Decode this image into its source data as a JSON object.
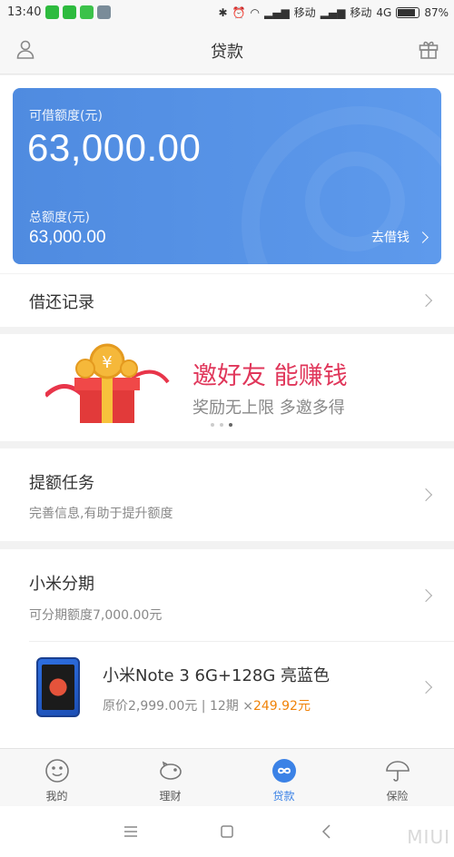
{
  "status_bar": {
    "time": "13:40",
    "carrier1": "移动",
    "carrier2": "移动",
    "network": "4G",
    "battery": "87%"
  },
  "app_bar": {
    "title": "贷款",
    "left_icon": "user-icon",
    "right_icon": "gift-icon"
  },
  "credit_card": {
    "available_label": "可借额度(元)",
    "available_amount": "63,000.00",
    "total_label": "总额度(元)",
    "total_amount": "63,000.00",
    "action_label": "去借钱"
  },
  "records": {
    "label": "借还记录"
  },
  "banner": {
    "headline": "邀好友 能赚钱",
    "subline": "奖励无上限 多邀多得",
    "page_count": 3,
    "active_page": 3
  },
  "tasks": {
    "title": "提额任务",
    "subtitle": "完善信息,有助于提升额度"
  },
  "installment": {
    "title": "小米分期",
    "subtitle": "可分期额度7,000.00元",
    "product_name": "小米Note 3 6G+128G 亮蓝色",
    "product_price_prefix": "原价2,999.00元 | 12期 ×",
    "product_installment": "249.92元"
  },
  "tab_bar": {
    "tabs": [
      {
        "label": "我的",
        "icon": "smile-icon"
      },
      {
        "label": "理财",
        "icon": "piggy-bank-icon"
      },
      {
        "label": "贷款",
        "icon": "loan-infinity-icon",
        "active": true
      },
      {
        "label": "保险",
        "icon": "umbrella-icon"
      }
    ]
  },
  "colors": {
    "card_blue": "#5b97ea",
    "active_tab": "#3b82e6",
    "banner_red": "#e0365a",
    "price_orange": "#f0830a"
  },
  "watermark": "MIUI"
}
